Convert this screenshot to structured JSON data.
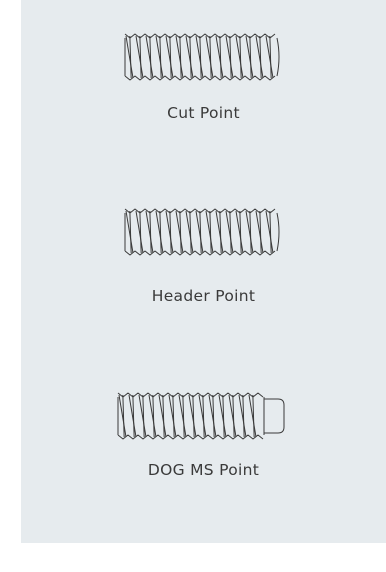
{
  "screws": [
    {
      "label": "Cut Point"
    },
    {
      "label": "Header Point"
    },
    {
      "label": "DOG MS Point"
    }
  ],
  "colors": {
    "panel_background": "#e6ebee",
    "page_background": "#ffffff",
    "line": "#3a3a3a",
    "text": "#3a3a3a"
  }
}
